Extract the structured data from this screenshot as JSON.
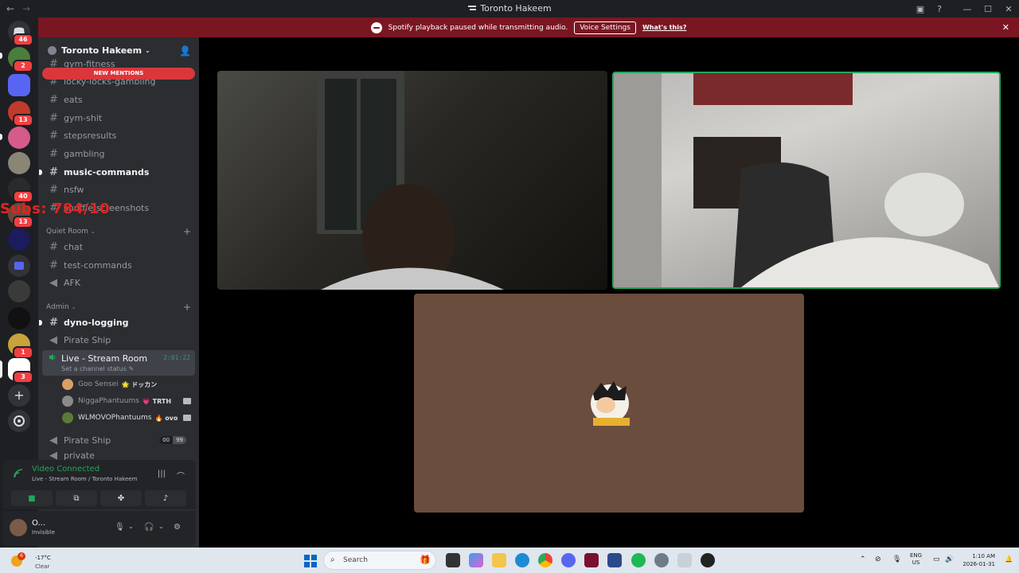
{
  "window": {
    "title": "Toronto Hakeem"
  },
  "banner": {
    "message": "Spotify playback paused while transmitting audio.",
    "voice_settings": "Voice Settings",
    "whats_this": "What's this?"
  },
  "rail": {
    "badges": [
      "46",
      "2",
      "13",
      "40",
      "13",
      "1",
      "3"
    ]
  },
  "server": {
    "name": "Toronto Hakeem",
    "new_mentions": "NEW MENTIONS",
    "channels_top": [
      {
        "name": "gym-fitness"
      },
      {
        "name": "locky-locks-gambling"
      },
      {
        "name": "eats"
      },
      {
        "name": "gym-shit"
      },
      {
        "name": "stepsresults"
      },
      {
        "name": "gambling"
      },
      {
        "name": "music-commands"
      },
      {
        "name": "nsfw"
      },
      {
        "name": "shuffle-screenshots"
      }
    ],
    "category_quiet": "Quiet Room",
    "quiet_channels": [
      {
        "name": "chat"
      },
      {
        "name": "test-commands"
      },
      {
        "name": "AFK"
      }
    ],
    "category_admin": "Admin",
    "admin_channels": [
      {
        "name": "dyno-logging"
      },
      {
        "name": "Pirate Ship"
      }
    ],
    "live": {
      "name": "Live - Stream Room",
      "time": "2:01:22",
      "status": "Set a channel status"
    },
    "voice_users": [
      {
        "name": "Goo Sensei",
        "tag": "ドッカン",
        "color": "#d9a066"
      },
      {
        "name": "NiggaPhantuums",
        "tag": "TRTH",
        "color": "#8a8a8a"
      },
      {
        "name": "WLMOVOPhantuums",
        "tag": "ovo",
        "color": "#5a7a3a"
      }
    ],
    "pirate2": {
      "name": "Pirate Ship",
      "count_a": "00",
      "count_b": "99"
    },
    "private": "private"
  },
  "overlay": {
    "subs_text": "Subs: 784/10"
  },
  "voice": {
    "status": "Video Connected",
    "location": "Live - Stream Room / Toronto Hakeem"
  },
  "user": {
    "name": "O...",
    "status": "Invisible"
  },
  "taskbar": {
    "temp": "-17°C",
    "condition": "Clear",
    "weather_badge": "6",
    "search": "Search",
    "lang_top": "ENG",
    "lang_bottom": "US",
    "time": "1:10 AM",
    "date": "2026-01-31"
  },
  "colors": {
    "banner": "#7a1622",
    "connected": "#23a55a",
    "mention": "#da373c"
  }
}
